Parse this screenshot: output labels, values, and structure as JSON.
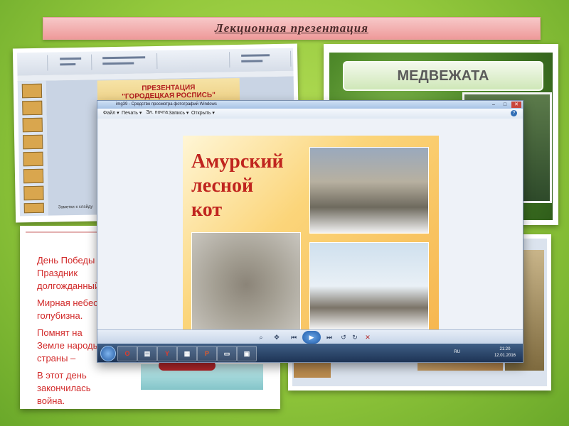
{
  "header": {
    "title": "Лекционная  презентация"
  },
  "ppt": {
    "slide_line1": "ПРЕЗЕНТАЦИЯ",
    "slide_line2": "\"ГОРОДЕЦКАЯ РОСПИСЬ\"",
    "status": "Заметки к слайду"
  },
  "bear": {
    "title": "МЕДВЕЖАТА"
  },
  "victory": {
    "paragraphs": [
      "День Победы – Праздник долгожданный,",
      "Мирная небес голубизна.",
      "Помнят на Земле народы, страны –",
      "В этот день закончилась война."
    ]
  },
  "viewer": {
    "window_title": "img39 - Средство просмотра фотографий Windows",
    "menu": [
      "Файл ▾",
      "Печать ▾",
      "Эл. почта",
      "Запись ▾",
      "Открыть ▾"
    ],
    "slide_title": [
      "Амурский",
      "лесной",
      "кот"
    ],
    "file_name": "img39",
    "lang": "RU",
    "clock_time": "21:20",
    "clock_date": "12.01.2016"
  }
}
